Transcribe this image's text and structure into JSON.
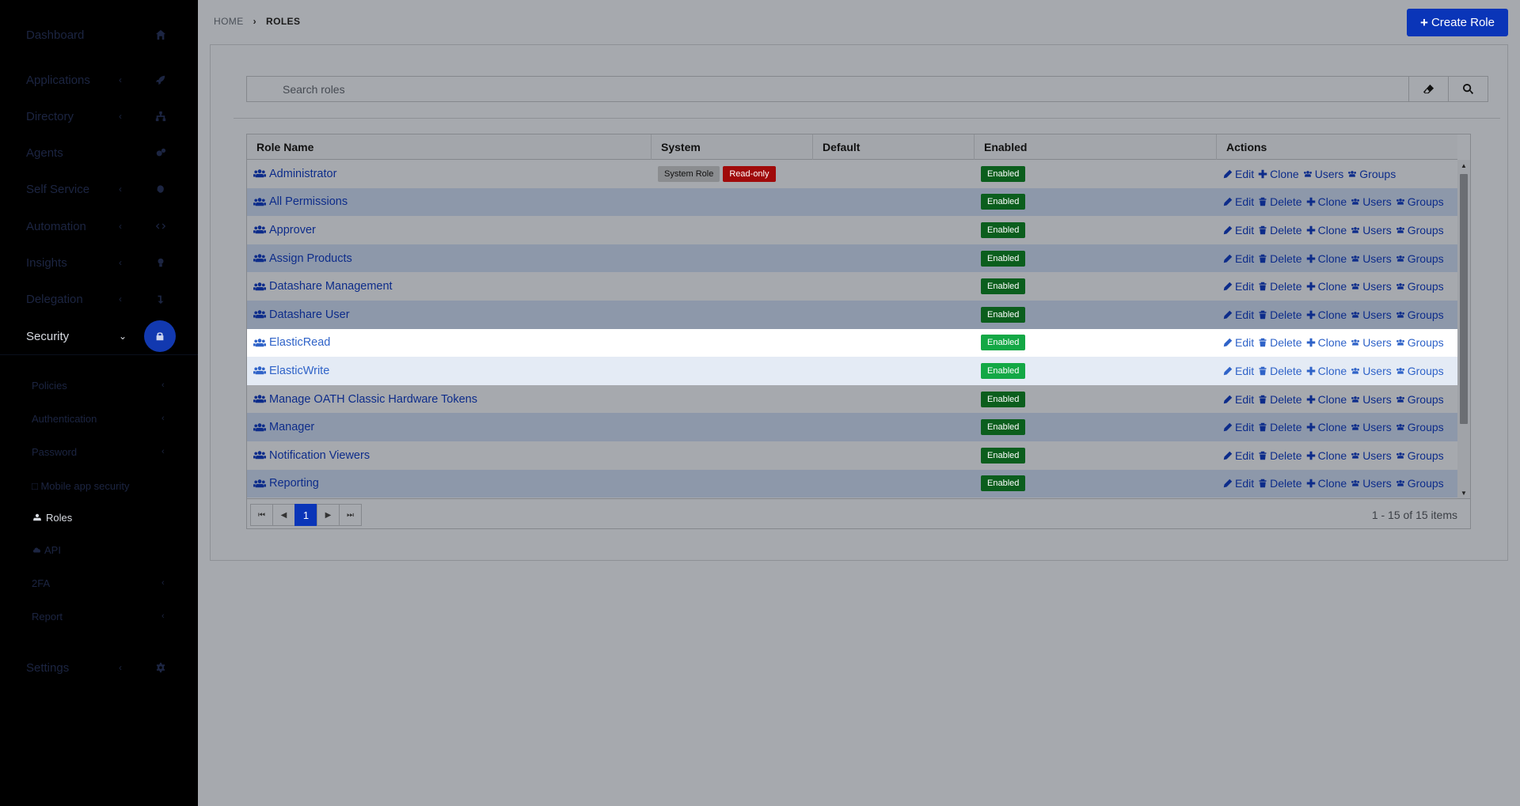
{
  "sidebar": {
    "items": [
      {
        "label": "Dashboard",
        "icon": "home-icon"
      },
      {
        "label": "Applications",
        "icon": "rocket-icon"
      },
      {
        "label": "Directory",
        "icon": "sitemap-icon"
      },
      {
        "label": "Agents",
        "icon": "cogs-icon"
      },
      {
        "label": "Self Service",
        "icon": "hand-icon"
      },
      {
        "label": "Automation",
        "icon": "code-icon"
      },
      {
        "label": "Insights",
        "icon": "lightbulb-icon"
      },
      {
        "label": "Delegation",
        "icon": "level-down-icon"
      },
      {
        "label": "Security",
        "icon": "lock-icon"
      }
    ],
    "security_sub": [
      {
        "label": "Policies"
      },
      {
        "label": "Authentication"
      },
      {
        "label": "Password"
      },
      {
        "label": "□ Mobile app security"
      },
      {
        "label": "Roles"
      },
      {
        "label": "API"
      },
      {
        "label": "2FA"
      },
      {
        "label": "Report"
      }
    ],
    "settings": {
      "label": "Settings",
      "icon": "gear-icon"
    }
  },
  "breadcrumb": {
    "home": "HOME",
    "current": "ROLES"
  },
  "toolbar": {
    "create_label": "Create Role"
  },
  "search": {
    "placeholder": "Search roles"
  },
  "grid": {
    "columns": [
      "Role Name",
      "System",
      "Default",
      "Enabled",
      "Actions"
    ],
    "rows": [
      {
        "name": "Administrator",
        "system": [
          "System Role",
          "Read-only"
        ],
        "enabled": "Enabled",
        "actions": [
          "Edit",
          "Clone",
          "Users",
          "Groups"
        ]
      },
      {
        "name": "All Permissions",
        "system": [],
        "enabled": "Enabled",
        "actions": [
          "Edit",
          "Delete",
          "Clone",
          "Users",
          "Groups"
        ]
      },
      {
        "name": "Approver",
        "system": [],
        "enabled": "Enabled",
        "actions": [
          "Edit",
          "Delete",
          "Clone",
          "Users",
          "Groups"
        ]
      },
      {
        "name": "Assign Products",
        "system": [],
        "enabled": "Enabled",
        "actions": [
          "Edit",
          "Delete",
          "Clone",
          "Users",
          "Groups"
        ]
      },
      {
        "name": "Datashare Management",
        "system": [],
        "enabled": "Enabled",
        "actions": [
          "Edit",
          "Delete",
          "Clone",
          "Users",
          "Groups"
        ]
      },
      {
        "name": "Datashare User",
        "system": [],
        "enabled": "Enabled",
        "actions": [
          "Edit",
          "Delete",
          "Clone",
          "Users",
          "Groups"
        ]
      },
      {
        "name": "ElasticRead",
        "system": [],
        "enabled": "Enabled",
        "actions": [
          "Edit",
          "Delete",
          "Clone",
          "Users",
          "Groups"
        ]
      },
      {
        "name": "ElasticWrite",
        "system": [],
        "enabled": "Enabled",
        "actions": [
          "Edit",
          "Delete",
          "Clone",
          "Users",
          "Groups"
        ]
      },
      {
        "name": "Manage OATH Classic Hardware Tokens",
        "system": [],
        "enabled": "Enabled",
        "actions": [
          "Edit",
          "Delete",
          "Clone",
          "Users",
          "Groups"
        ]
      },
      {
        "name": "Manager",
        "system": [],
        "enabled": "Enabled",
        "actions": [
          "Edit",
          "Delete",
          "Clone",
          "Users",
          "Groups"
        ]
      },
      {
        "name": "Notification Viewers",
        "system": [],
        "enabled": "Enabled",
        "actions": [
          "Edit",
          "Delete",
          "Clone",
          "Users",
          "Groups"
        ]
      },
      {
        "name": "Reporting",
        "system": [],
        "enabled": "Enabled",
        "actions": [
          "Edit",
          "Delete",
          "Clone",
          "Users",
          "Groups"
        ]
      }
    ]
  },
  "pager": {
    "current_page": "1",
    "info": "1 - 15 of 15 items"
  },
  "colors": {
    "accent": "#0a35b8",
    "enabled": "#0b5e1d",
    "readonly": "#a00a0a"
  }
}
